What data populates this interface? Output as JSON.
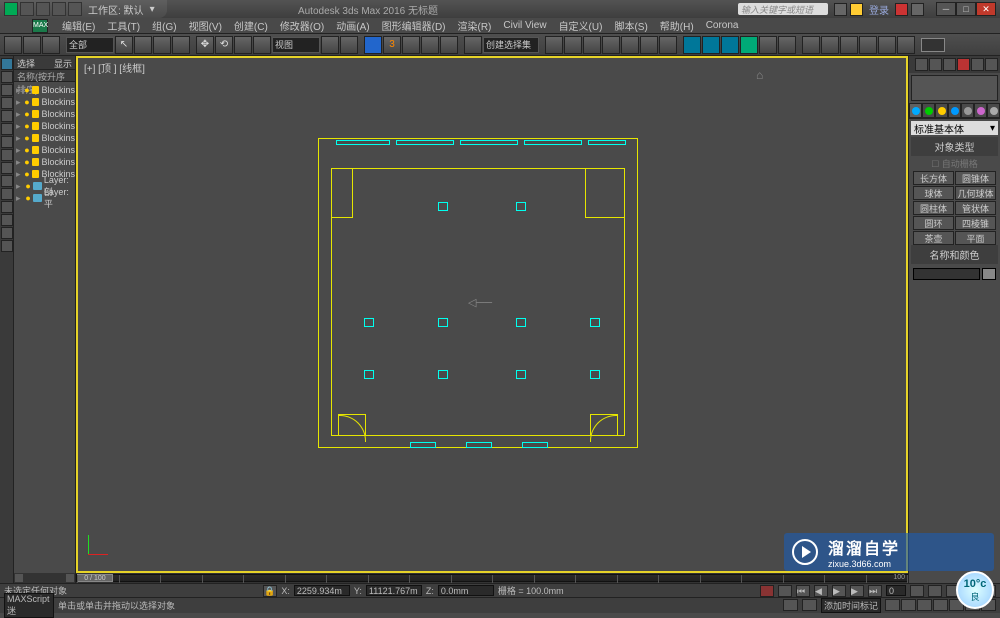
{
  "title_center": "Autodesk 3ds Max 2016   无标题",
  "workspace_label": "工作区: 默认",
  "search_placeholder": "输入关键字或短语",
  "login_label": "登录",
  "menu": [
    "编辑(E)",
    "工具(T)",
    "组(G)",
    "视图(V)",
    "创建(C)",
    "修改器(O)",
    "动画(A)",
    "图形编辑器(D)",
    "渲染(R)",
    "Civil View",
    "自定义(U)",
    "脚本(S)",
    "帮助(H)",
    "Corona"
  ],
  "toolbar_dropdown1": "全部",
  "toolbar_dropdown2": "视图",
  "toolbar_dropdown3": "创建选择集",
  "se_header_left": "选择",
  "se_header_right": "显示",
  "se_sort": "名称(按升序排序)",
  "se_items": [
    {
      "type": "block",
      "label": "Blockins"
    },
    {
      "type": "block",
      "label": "Blockins"
    },
    {
      "type": "block",
      "label": "Blockins"
    },
    {
      "type": "block",
      "label": "Blockins"
    },
    {
      "type": "block",
      "label": "Blockins"
    },
    {
      "type": "block",
      "label": "Blockins"
    },
    {
      "type": "block",
      "label": "Blockins"
    },
    {
      "type": "block",
      "label": "Blockins"
    },
    {
      "type": "layer",
      "label": "Layer:剖"
    },
    {
      "type": "layer",
      "label": "Layer:平"
    }
  ],
  "viewport_label": "[+] [顶 ] [线框]",
  "cp_dropdown": "标准基本体",
  "cp_section1": "对象类型",
  "cp_auto": "自动栅格",
  "cp_buttons": [
    "长方体",
    "圆锥体",
    "球体",
    "几何球体",
    "圆柱体",
    "管状体",
    "圆环",
    "四棱锥",
    "茶壶",
    "平面"
  ],
  "cp_section2": "名称和颜色",
  "timeline_slider": "0 / 100",
  "timeline_end": "100",
  "status_sel": "未选定任何对象",
  "status_x": "2259.934m",
  "status_y": "11121.767m",
  "status_z": "0.0mm",
  "status_grid": "栅格 = 100.0mm",
  "status_script": "MAXScript 迷",
  "status_prompt": "单击或单击并拖动以选择对象",
  "status_addtime": "添加时间标记",
  "wm_big": "溜溜自学",
  "wm_small": "zixue.3d66.com",
  "weather_temp": "10°c",
  "weather_cond": "良"
}
